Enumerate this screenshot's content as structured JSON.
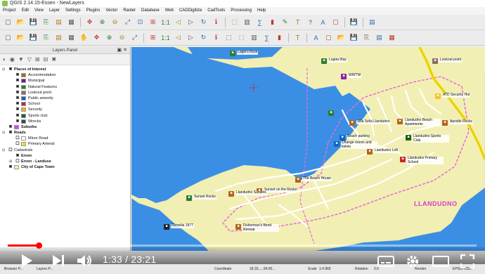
{
  "window": {
    "title": "QGIS 2.14.15-Essen - NewLayers"
  },
  "menu": [
    "Project",
    "Edit",
    "View",
    "Layer",
    "Settings",
    "Plugins",
    "Vector",
    "Raster",
    "Database",
    "Web",
    "CADDigitize",
    "CadTools",
    "Processing",
    "Help"
  ],
  "layers_panel": {
    "title": "Layers Panel",
    "tree": [
      {
        "label": "Places of Interest",
        "bold": true,
        "level": 0,
        "expand": "−",
        "checked": true
      },
      {
        "label": "Accommodation",
        "level": 1,
        "checked": true,
        "symbol": "#b5651d"
      },
      {
        "label": "Municipal",
        "level": 1,
        "checked": true,
        "symbol": "#6a1b9a"
      },
      {
        "label": "Natural Features",
        "level": 1,
        "checked": true,
        "symbol": "#2e7d32"
      },
      {
        "label": "Lookout point",
        "level": 1,
        "checked": true,
        "symbol": "#8d6e63"
      },
      {
        "label": "Public amenity",
        "level": 1,
        "checked": true,
        "symbol": "#1565c0"
      },
      {
        "label": "School",
        "level": 1,
        "checked": true,
        "symbol": "#c62828"
      },
      {
        "label": "Security",
        "level": 1,
        "checked": true,
        "symbol": "#f9a825"
      },
      {
        "label": "Sports club",
        "level": 1,
        "checked": true,
        "symbol": "#1b5e20"
      },
      {
        "label": "Wrecks",
        "level": 1,
        "checked": true,
        "symbol": "#37474f"
      },
      {
        "label": "Suburbs",
        "bold": true,
        "level": 0,
        "checked": true,
        "symbol": "#e040fb"
      },
      {
        "label": "Roads",
        "bold": true,
        "level": 0,
        "expand": "−",
        "checked": true
      },
      {
        "label": "Minor Road",
        "level": 1,
        "checked": false,
        "symbol": "#ffffff"
      },
      {
        "label": "Primary Arterial",
        "level": 1,
        "checked": false,
        "symbol": "#f4e11b"
      },
      {
        "label": "Cadastrals",
        "level": 0,
        "expand": "−",
        "checked": false
      },
      {
        "label": "Erven",
        "bold": true,
        "level": 1,
        "checked": true
      },
      {
        "label": "Erven - Landuse",
        "bold": true,
        "level": 1,
        "expand": "+",
        "checked": false
      },
      {
        "label": "City of Cape Town",
        "bold": true,
        "level": 0,
        "checked": true,
        "symbol": "#f1eeb3"
      }
    ]
  },
  "map": {
    "town_label": "LLANDUDNO",
    "pois": [
      {
        "label": "Logie's Rock",
        "color": "#2e7d32"
      },
      {
        "label": "Logies Bay",
        "color": "#2e7d32"
      },
      {
        "label": "WWTW",
        "color": "#8e24aa"
      },
      {
        "label": "Lookout point",
        "color": "#8d6e63"
      },
      {
        "label": "ATD Security Hut",
        "color": "#fbc02d"
      },
      {
        "label": "Villa Sella Llandudno",
        "color": "#b5651d"
      },
      {
        "label": "Llandudno Beach Apartments",
        "color": "#b5651d"
      },
      {
        "label": "Apostle Rocks",
        "color": "#b5651d"
      },
      {
        "label": "Beach parking",
        "color": "#1565c0"
      },
      {
        "label": "Change rooms and toilets",
        "color": "#1565c0"
      },
      {
        "label": "Llandudno Sports Club",
        "color": "#1b5e20"
      },
      {
        "label": "Llandudno Loft",
        "color": "#b5651d"
      },
      {
        "label": "Llandudno Primary School",
        "color": "#c62828"
      },
      {
        "label": "The Beach House",
        "color": "#b5651d"
      },
      {
        "label": "Sunset on the Rocks",
        "color": "#b5651d"
      },
      {
        "label": "Llandudno Sunsets",
        "color": "#b5651d"
      },
      {
        "label": "Sunset Rocks",
        "color": "#2e7d32"
      },
      {
        "label": "Fisherman's Bend Retreat",
        "color": "#b5651d"
      },
      {
        "label": "Romelia 1977",
        "color": "#222"
      }
    ]
  },
  "status": {
    "browser_tab": "Browser P...",
    "layers_tab": "Layers P...",
    "coordinate_label": "Coordinate",
    "coordinate": "18.33...,-34.00...",
    "scale_label": "Scale",
    "scale": "1:4 865",
    "rotation_label": "Rotation",
    "rotation": "0.0",
    "render_label": "Render",
    "crs": "EPSG:4326"
  },
  "video": {
    "time_current": "1:33",
    "time_total": "23:21",
    "progress": 0.066
  }
}
